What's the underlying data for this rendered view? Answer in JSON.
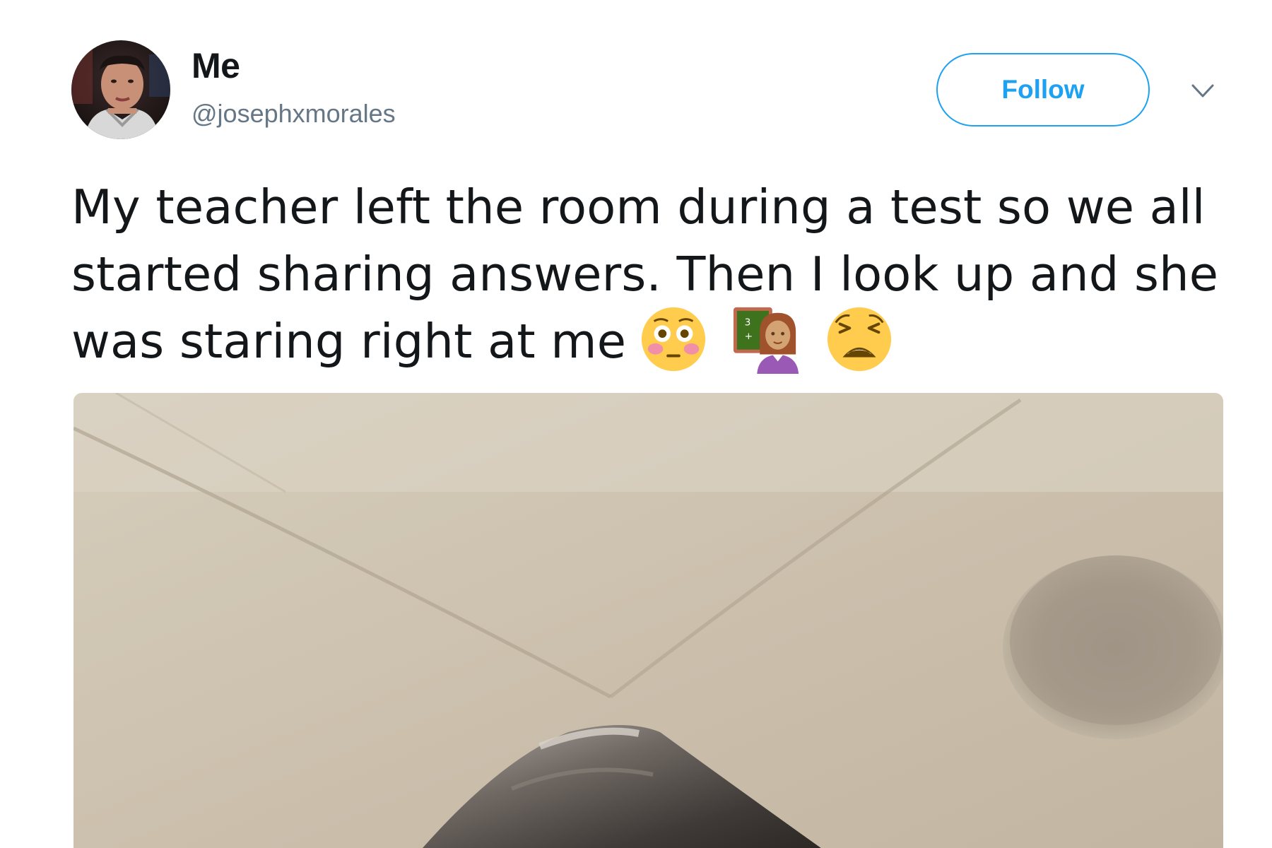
{
  "user": {
    "display_name": "Me",
    "handle": "@josephxmorales",
    "avatar_icon": "profile-photo"
  },
  "actions": {
    "follow_label": "Follow",
    "menu_icon": "chevron-down-icon"
  },
  "tweet": {
    "text": "My teacher left the room during a test so we all started sharing answers. Then I look up and she was staring right at me",
    "emojis": [
      "flushed-face-emoji",
      "woman-teacher-emoji",
      "weary-face-emoji"
    ]
  },
  "media": {
    "description_icon": "attached-photo"
  },
  "colors": {
    "accent": "#1da1f2",
    "text": "#14171a",
    "secondary": "#657786"
  }
}
